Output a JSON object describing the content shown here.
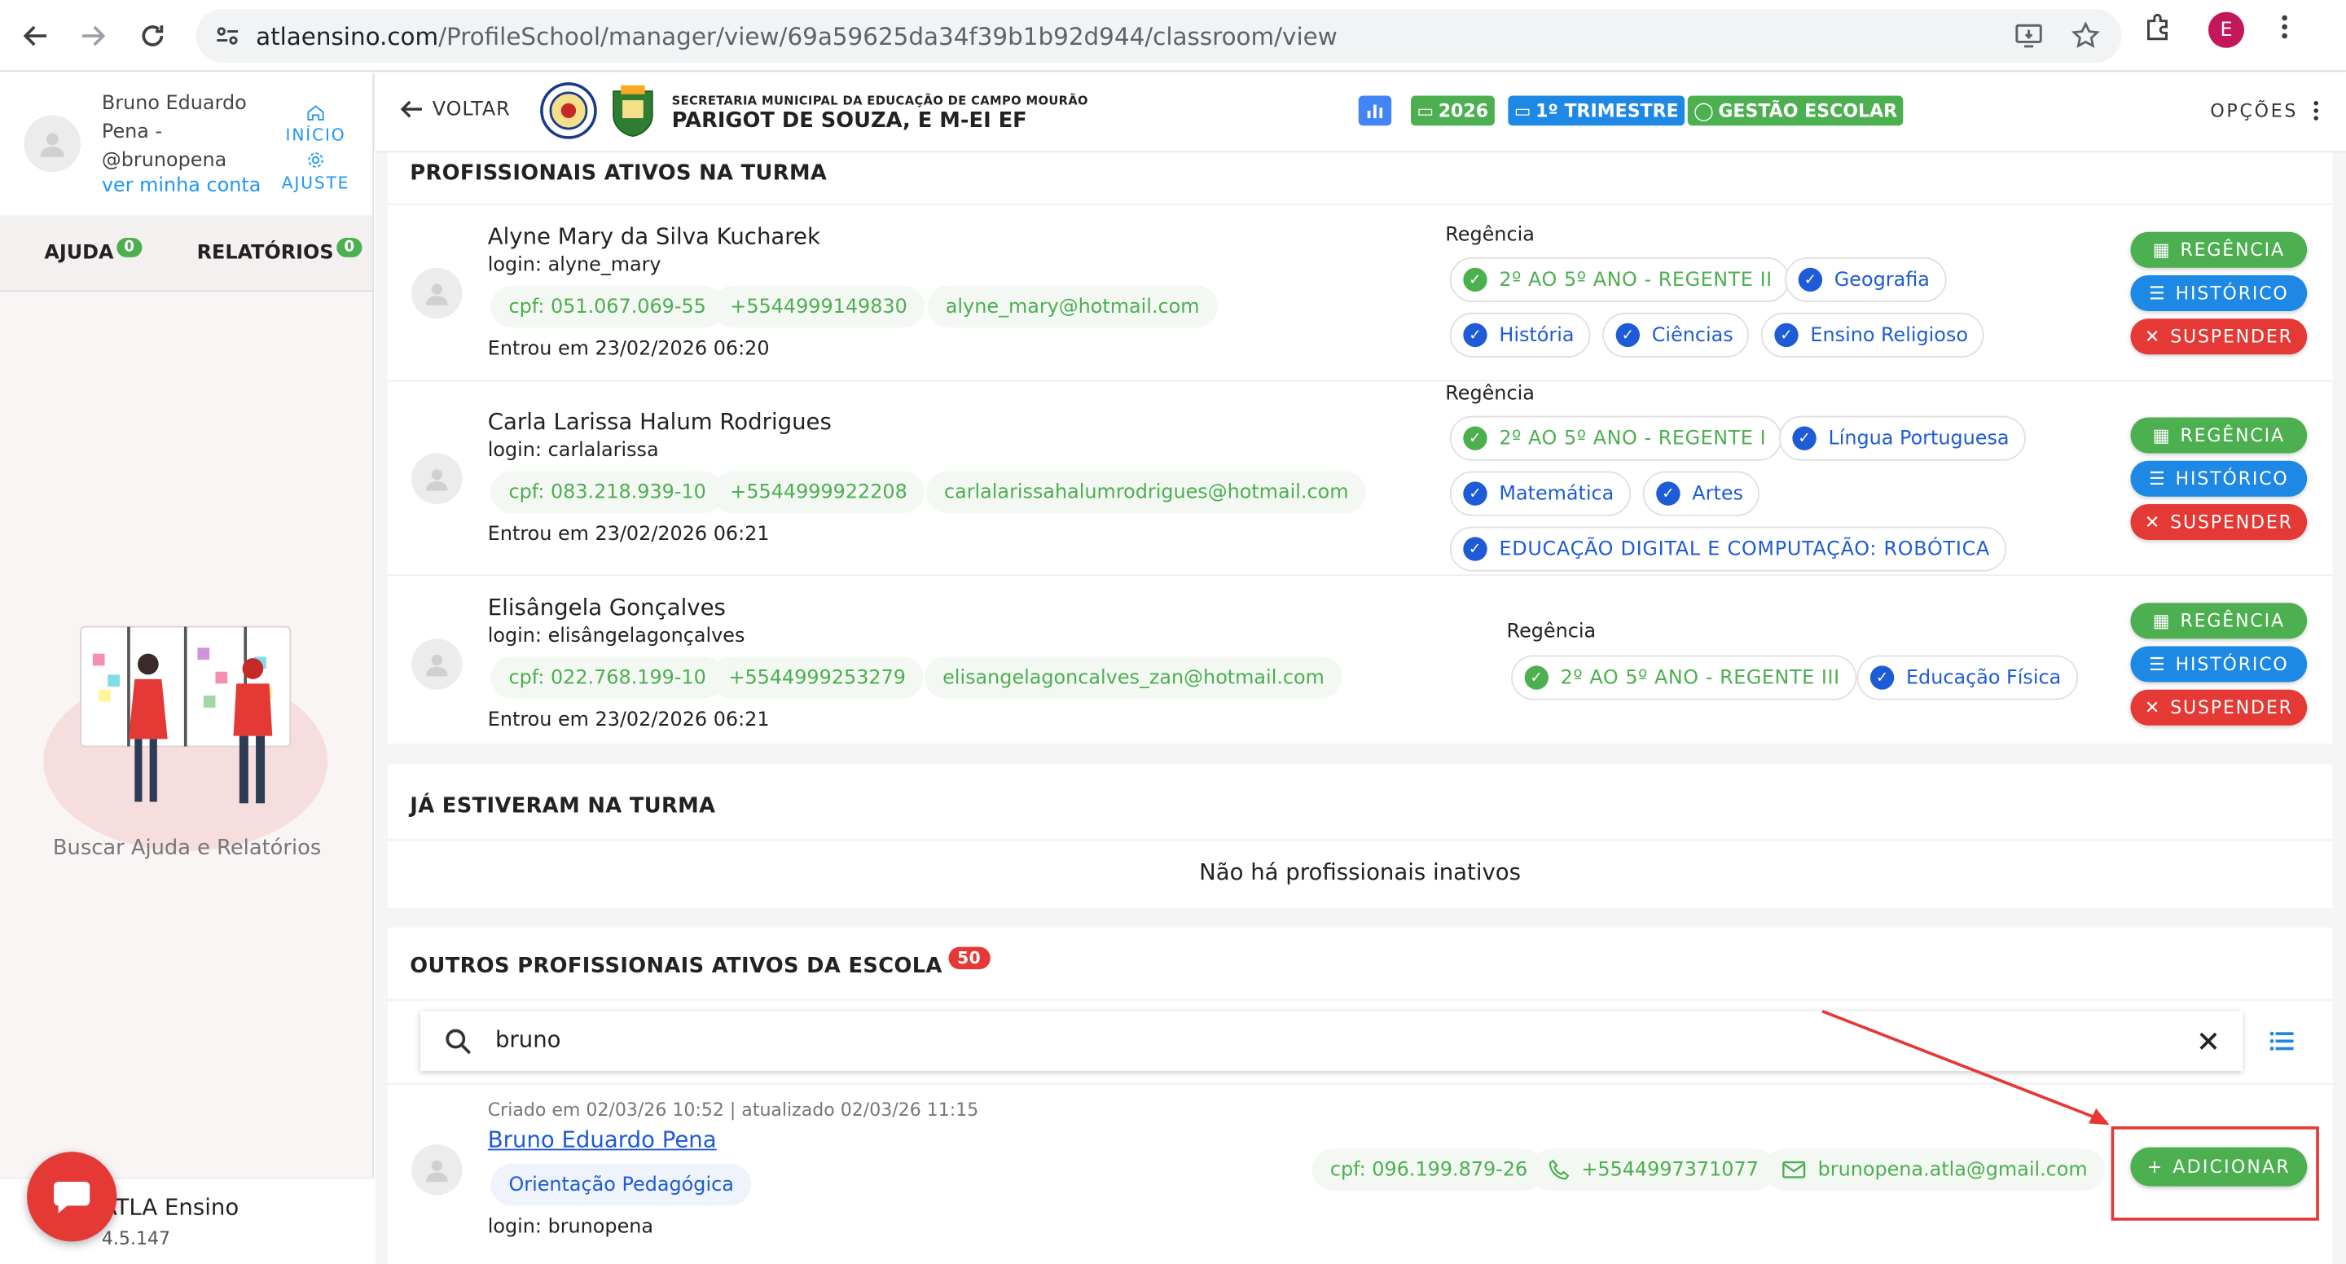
{
  "browser": {
    "url_host": "atlaensino.com",
    "url_path": "/ProfileSchool/manager/view/69a59625da34f39b1b92d944/classroom/view",
    "profile_initial": "E"
  },
  "sidebar": {
    "user_name": "Bruno Eduardo Pena - @brunopena",
    "view_account": "ver minha conta",
    "home_label": "INÍCIO",
    "settings_label": "AJUSTE",
    "tabs": [
      {
        "label": "AJUDA",
        "count": "0"
      },
      {
        "label": "RELATÓRIOS",
        "count": "0"
      }
    ],
    "help_text": "Buscar Ajuda e Relatórios",
    "app_name": "ATLA Ensino",
    "app_version": "4.5.147"
  },
  "header": {
    "back_label": "VOLTAR",
    "school_sub": "SECRETARIA MUNICIPAL DA EDUCAÇÃO DE CAMPO MOURÃO",
    "school_name": "PARIGOT DE SOUZA, E M-EI EF",
    "chips": [
      "2026",
      "1º TRIMESTRE",
      "GESTÃO ESCOLAR"
    ],
    "options_label": "OPÇÕES"
  },
  "active": {
    "title": "PROFISSIONAIS ATIVOS NA TURMA",
    "regencia_label": "Regência",
    "professionals": [
      {
        "name": "Alyne Mary da Silva Kucharek",
        "login": "login: alyne_mary",
        "cpf": "cpf: 051.067.069-55",
        "phone": "+5544999149830",
        "email": "alyne_mary@hotmail.com",
        "joined": "Entrou em 23/02/2026 06:20",
        "chips": [
          "2º AO 5º ANO - REGENTE II",
          "Geografia",
          "História",
          "Ciências",
          "Ensino Religioso"
        ]
      },
      {
        "name": "Carla Larissa Halum Rodrigues",
        "login": "login: carlalarissa",
        "cpf": "cpf: 083.218.939-10",
        "phone": "+5544999922208",
        "email": "carlalarissahalumrodrigues@hotmail.com",
        "joined": "Entrou em 23/02/2026 06:21",
        "chips": [
          "2º AO 5º ANO - REGENTE I",
          "Língua Portuguesa",
          "Matemática",
          "Artes",
          "EDUCAÇÃO DIGITAL E COMPUTAÇÃO: ROBÓTICA"
        ]
      },
      {
        "name": "Elisângela Gonçalves",
        "login": "login: elisângelagonçalves",
        "cpf": "cpf: 022.768.199-10",
        "phone": "+5544999253279",
        "email": "elisangelagoncalves_zan@hotmail.com",
        "joined": "Entrou em 23/02/2026 06:21",
        "chips": [
          "2º AO 5º ANO - REGENTE III",
          "Educação Física"
        ]
      }
    ],
    "buttons": {
      "regencia": "REGÊNCIA",
      "historico": "HISTÓRICO",
      "suspender": "SUSPENDER"
    }
  },
  "inactive": {
    "title": "JÁ ESTIVERAM NA TURMA",
    "empty_text": "Não há profissionais inativos"
  },
  "others": {
    "title": "OUTROS PROFISSIONAIS ATIVOS DA ESCOLA",
    "count": "50",
    "search_value": "bruno",
    "result": {
      "meta": "Criado em 02/03/26 10:52 | atualizado 02/03/26 11:15",
      "name": "Bruno Eduardo Pena",
      "role": "Orientação Pedagógica",
      "login": "login: brunopena",
      "cpf": "cpf: 096.199.879-26",
      "phone": "+5544997371077",
      "email": "brunopena.atla@gmail.com",
      "add_label": "ADICIONAR"
    }
  }
}
